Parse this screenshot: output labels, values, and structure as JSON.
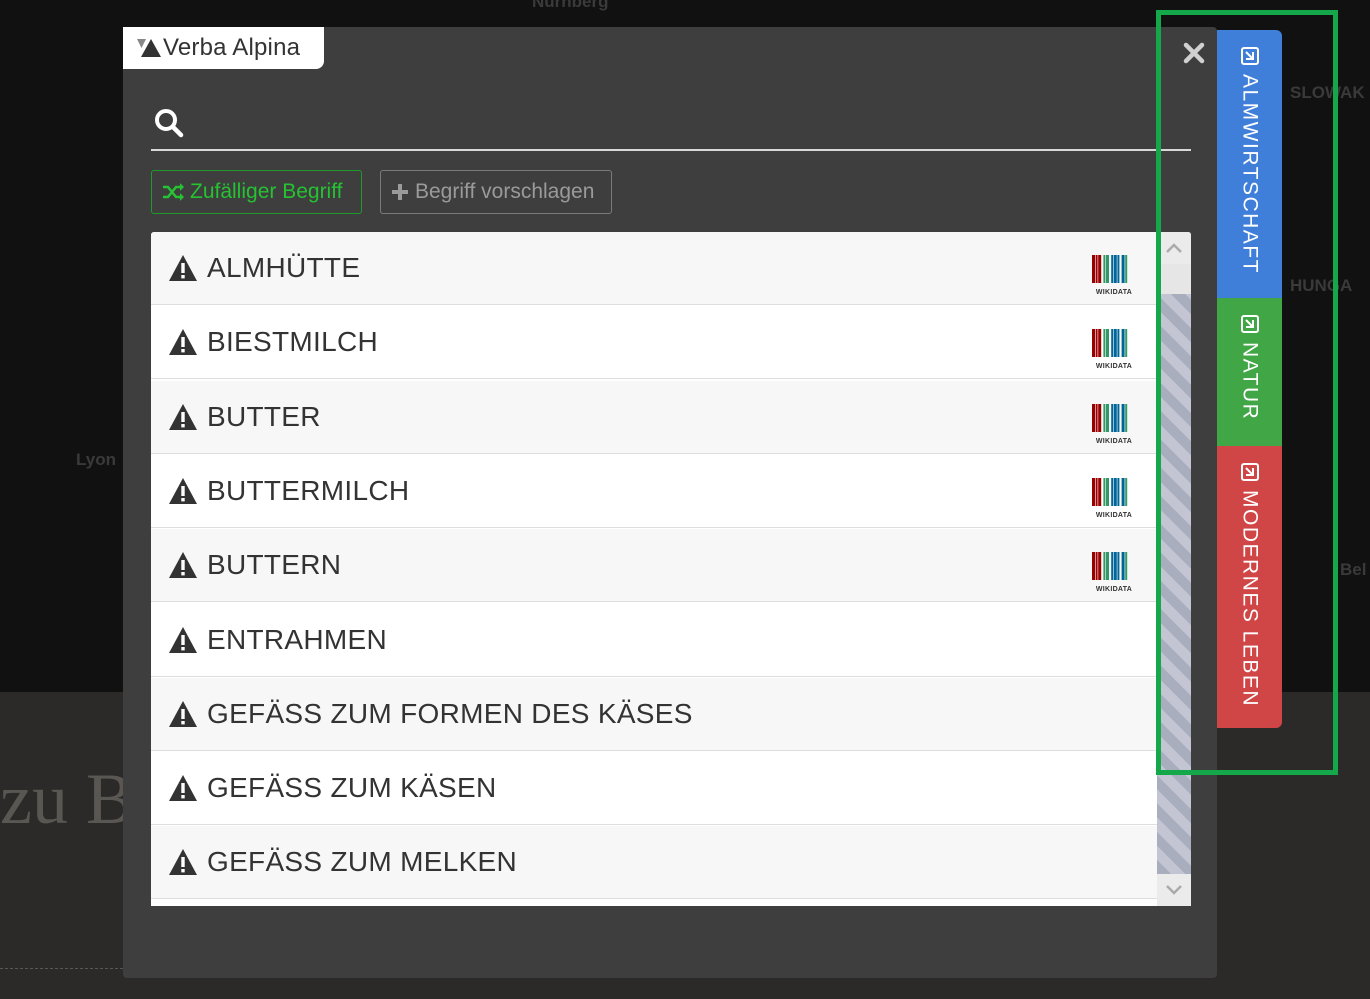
{
  "background": {
    "cities": [
      "Nürnberg",
      "Lyon",
      "SLOWAK",
      "HUNGA",
      "Bel"
    ],
    "heading_fragment": "zu B"
  },
  "modal": {
    "logo_text": "Verba Alpina",
    "search": {
      "placeholder": "",
      "value": ""
    },
    "buttons": {
      "random_label": "Zufälliger Begriff",
      "suggest_label": "Begriff vorschlagen"
    },
    "items": [
      {
        "label": "ALMHÜTTE",
        "wikidata": true
      },
      {
        "label": "BIESTMILCH",
        "wikidata": true
      },
      {
        "label": "BUTTER",
        "wikidata": true
      },
      {
        "label": "BUTTERMILCH",
        "wikidata": true
      },
      {
        "label": "BUTTERN",
        "wikidata": true
      },
      {
        "label": "ENTRAHMEN",
        "wikidata": false
      },
      {
        "label": "GEFÄSS ZUM FORMEN DES KÄSES",
        "wikidata": false
      },
      {
        "label": "GEFÄSS ZUM KÄSEN",
        "wikidata": false
      },
      {
        "label": "GEFÄSS ZUM MELKEN",
        "wikidata": false
      }
    ],
    "wikidata_caption": "WIKIDATA"
  },
  "side_tabs": [
    {
      "label": "ALMWIRTSCHAFT",
      "color": "#3f7fd9"
    },
    {
      "label": "NATUR",
      "color": "#41a645"
    },
    {
      "label": "MODERNES LEBEN",
      "color": "#d04545"
    }
  ],
  "colors": {
    "highlight": "#14a84a",
    "modal_bg": "#3e3e3e",
    "random_button": "#25c232"
  }
}
